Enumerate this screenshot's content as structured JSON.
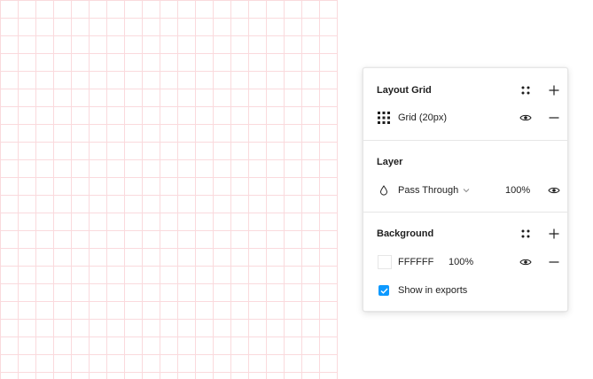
{
  "layout_grid": {
    "title": "Layout Grid",
    "grid_label": "Grid (20px)",
    "grid_size": 20,
    "grid_color": "#fadadd"
  },
  "layer": {
    "title": "Layer",
    "blend_mode": "Pass Through",
    "opacity": "100%"
  },
  "background": {
    "title": "Background",
    "hex": "FFFFFF",
    "opacity": "100%",
    "show_in_exports_label": "Show in exports",
    "show_in_exports": true
  },
  "colors": {
    "accent": "#0d99ff",
    "text": "#1e1e1e",
    "border": "#e6e6e6"
  },
  "icons": {
    "styles": "styles-icon",
    "add": "plus-icon",
    "remove": "minus-icon",
    "visibility": "eye-icon",
    "grid": "grid-icon",
    "blend": "blend-drop-icon",
    "dropdown": "chevron-down-icon",
    "check": "check-icon"
  }
}
